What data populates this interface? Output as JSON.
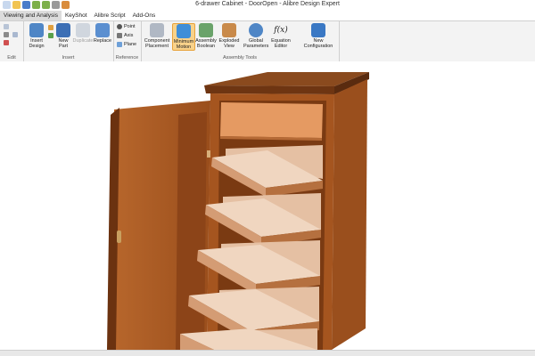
{
  "window": {
    "title": "6-drawer Cabinet - DoorOpen - Alibre Design Expert"
  },
  "menu": {
    "tabs": [
      {
        "label": "Viewing and Analysis"
      },
      {
        "label": "KeyShot"
      },
      {
        "label": "Alibre Script"
      },
      {
        "label": "Add-Ons"
      }
    ]
  },
  "ribbon": {
    "groups": {
      "edit": "Edit",
      "insert": "Insert",
      "reference": "Reference",
      "assembly_tools": "Assembly Tools"
    },
    "buttons": {
      "insert_design": "Insert Design",
      "new_part": "New Part",
      "duplicate": "Duplicate",
      "replace": "Replace",
      "point": "Point",
      "axis": "Axis",
      "plane": "Plane",
      "component_placement": "Component Placement",
      "minimum_motion": "Minimum Motion",
      "assembly_boolean": "Assembly Boolean",
      "exploded_view": "Exploded View",
      "global_parameters": "Global Parameters",
      "equation_editor": "Equation Editor",
      "equation_symbol": "f(x)",
      "new_configuration": "New Configuration"
    }
  },
  "colors": {
    "wood": "#a5551f",
    "wood_dark": "#7a3a12",
    "drawer_light": "#f2d6bf",
    "drawer_mid": "#e0b18d",
    "ribbon_bg": "#f3f3f3",
    "highlight": "#f9d28a"
  },
  "icons": {
    "save": "save-icon",
    "undo": "undo-icon",
    "redo": "redo-icon",
    "insert_design": "insert-design-icon",
    "new_part": "new-part-icon",
    "minimum_motion": "minimum-motion-icon",
    "global_parameters": "global-parameters-icon"
  }
}
